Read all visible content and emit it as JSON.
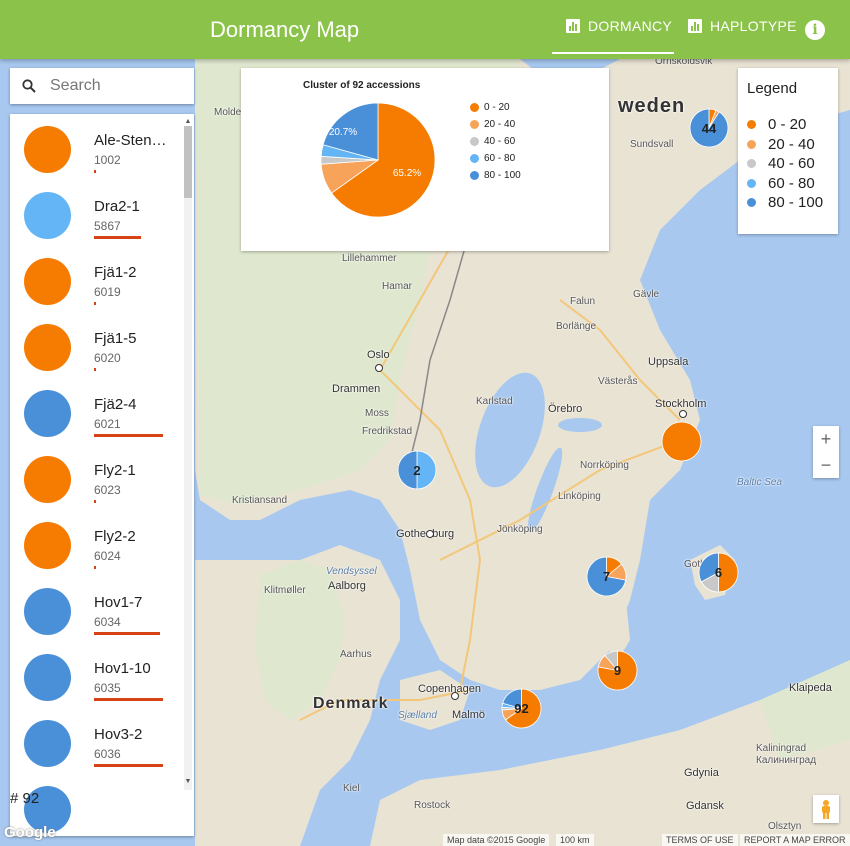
{
  "header": {
    "title": "Dormancy Map",
    "tabs": [
      {
        "label": "DORMANCY",
        "active": true
      },
      {
        "label": "HAPLOTYPE",
        "active": false
      }
    ],
    "info_label": "i"
  },
  "search": {
    "placeholder": "Search"
  },
  "accessions": [
    {
      "name": "Ale-Stenar...",
      "id": "1002",
      "color": "#f57c00",
      "bar_fraction": 0.02
    },
    {
      "name": "Dra2-1",
      "id": "5867",
      "color": "#64b5f6",
      "bar_fraction": 0.65
    },
    {
      "name": "Fjä1-2",
      "id": "6019",
      "color": "#f57c00",
      "bar_fraction": 0.02
    },
    {
      "name": "Fjä1-5",
      "id": "6020",
      "color": "#f57c00",
      "bar_fraction": 0.0
    },
    {
      "name": "Fjä2-4",
      "id": "6021",
      "color": "#4a90d9",
      "bar_fraction": 0.96
    },
    {
      "name": "Fly2-1",
      "id": "6023",
      "color": "#f57c00",
      "bar_fraction": 0.02
    },
    {
      "name": "Fly2-2",
      "id": "6024",
      "color": "#f57c00",
      "bar_fraction": 0.0
    },
    {
      "name": "Hov1-7",
      "id": "6034",
      "color": "#4a90d9",
      "bar_fraction": 0.92
    },
    {
      "name": "Hov1-10",
      "id": "6035",
      "color": "#4a90d9",
      "bar_fraction": 0.96
    },
    {
      "name": "Hov3-2",
      "id": "6036",
      "color": "#4a90d9",
      "bar_fraction": 0.96
    }
  ],
  "list_count": "# 92",
  "popup": {
    "title": "Cluster of 92 accessions",
    "slice_labels": [
      "65.2%",
      "20.7%"
    ]
  },
  "chart_data": {
    "type": "pie",
    "title": "Cluster of 92 accessions",
    "categories": [
      "0 - 20",
      "20 - 40",
      "40 - 60",
      "60 - 80",
      "80 - 100"
    ],
    "values": [
      65.2,
      8.7,
      2.2,
      3.3,
      20.7
    ],
    "colors": [
      "#f57c00",
      "#f8a35a",
      "#c8c8c8",
      "#64b5f6",
      "#4a90d9"
    ]
  },
  "legend": {
    "title": "Legend",
    "items": [
      {
        "label": "0 - 20",
        "color": "#f57c00"
      },
      {
        "label": "20 - 40",
        "color": "#f8a35a"
      },
      {
        "label": "40 - 60",
        "color": "#c8c8c8"
      },
      {
        "label": "60 - 80",
        "color": "#64b5f6"
      },
      {
        "label": "80 - 100",
        "color": "#4a90d9"
      }
    ]
  },
  "clusters": [
    {
      "label": "44",
      "fractions": [
        0.06,
        0.03,
        0,
        0,
        0.91
      ]
    },
    {
      "label": "",
      "fractions": [
        1,
        0,
        0,
        0,
        0
      ]
    },
    {
      "label": "2",
      "fractions": [
        0,
        0,
        0,
        0.5,
        0.5
      ]
    },
    {
      "label": "7",
      "fractions": [
        0.14,
        0.14,
        0,
        0,
        0.72
      ]
    },
    {
      "label": "6",
      "fractions": [
        0.5,
        0,
        0.17,
        0,
        0.33
      ]
    },
    {
      "label": "9",
      "fractions": [
        0.78,
        0.11,
        0.11,
        0,
        0
      ]
    },
    {
      "label": "92",
      "fractions": [
        0.652,
        0.087,
        0.022,
        0.033,
        0.207
      ]
    }
  ],
  "map_labels": {
    "sweden": "weden",
    "denmark": "Denmark",
    "places": [
      "Örnsköldsvik",
      "Molde",
      "Sundsvall",
      "Lillehammer",
      "Hamar",
      "Gävle",
      "Falun",
      "Borlänge",
      "Oslo",
      "Drammen",
      "Moss",
      "Fredrikstad",
      "Karlstad",
      "Uppsala",
      "Västerås",
      "Örebro",
      "Stockholm",
      "Norrköping",
      "Linköping",
      "Kristiansand",
      "Jönköping",
      "Gothenburg",
      "Vendsyssel",
      "Aalborg",
      "Klitmøller",
      "Gotland",
      "Aarhus",
      "Copenhagen",
      "Sjælland",
      "Malmö",
      "Klaipeda",
      "Kaliningrad",
      "Калининград",
      "Gdynia",
      "Gdansk",
      "Kiel",
      "Rostock",
      "Olsztyn"
    ],
    "sea": "Baltic Sea"
  },
  "zoom": {
    "in": "+",
    "out": "−"
  },
  "footer": {
    "attribution": "Map data ©2015 Google",
    "scale": "100 km",
    "terms": "TERMS OF USE",
    "report": "REPORT A MAP ERROR"
  },
  "google_logo": "Google"
}
